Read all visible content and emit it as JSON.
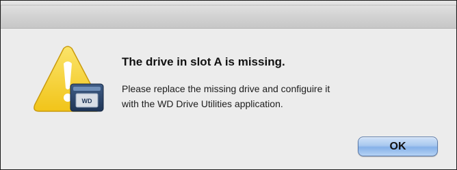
{
  "dialog": {
    "title": "The drive in slot A is missing.",
    "message_lines": [
      "Please replace the missing drive and configuire it",
      "with the WD Drive Utilities application."
    ],
    "icon": "caution-drive-icon",
    "drive_badge_text": "WD"
  },
  "buttons": {
    "ok_label": "OK"
  },
  "colors": {
    "warning_yellow": "#f6d334",
    "default_button_blue": "#a9c8ef",
    "dialog_background": "#ececec"
  }
}
